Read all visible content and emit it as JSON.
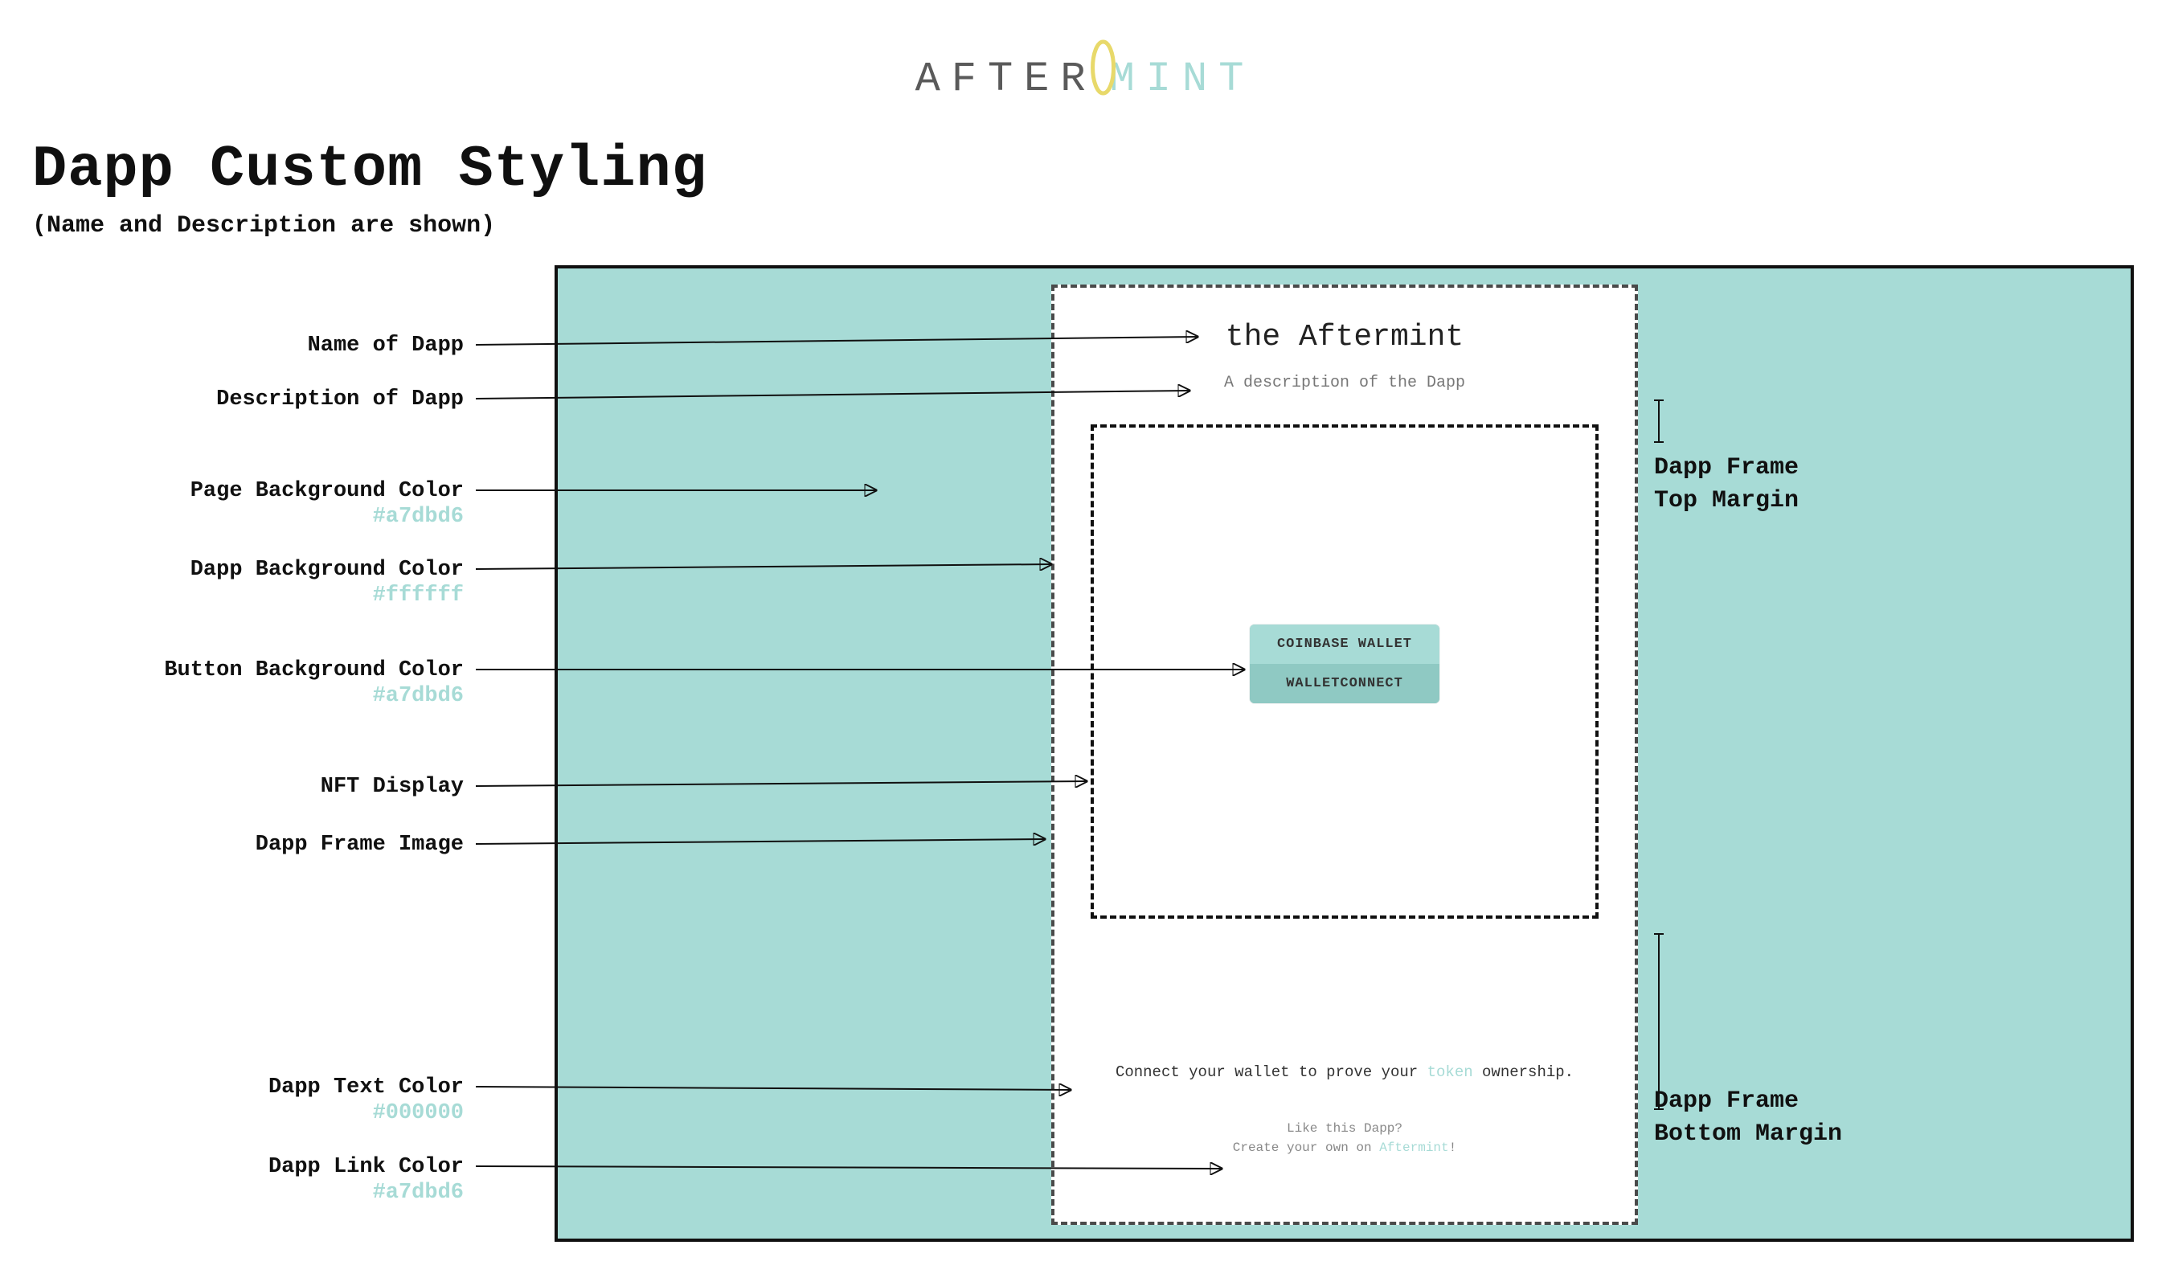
{
  "logo": {
    "left": "AFTER",
    "right": "MINT"
  },
  "heading": {
    "title": "Dapp Custom Styling",
    "subtitle": "(Name and Description are shown)"
  },
  "dapp": {
    "name": "the Aftermint",
    "description": "A description of the Dapp",
    "connect_prefix": "Connect your wallet to prove your ",
    "connect_link": "token",
    "connect_suffix": " ownership.",
    "like": "Like this Dapp?",
    "create_prefix": "Create your own on ",
    "create_link": "Aftermint",
    "create_suffix": "!",
    "btn_coinbase": "COINBASE WALLET",
    "btn_walletconnect": "WALLETCONNECT"
  },
  "labels": {
    "name": "Name of Dapp",
    "desc": "Description of Dapp",
    "page_bg": "Page Background Color",
    "page_bg_hex": "#a7dbd6",
    "dapp_bg": "Dapp Background Color",
    "dapp_bg_hex": "#ffffff",
    "btn_bg": "Button Background Color",
    "btn_bg_hex": "#a7dbd6",
    "nft": "NFT Display",
    "frame_img": "Dapp Frame Image",
    "text_color": "Dapp Text Color",
    "text_color_hex": "#000000",
    "link_color": "Dapp Link Color",
    "link_color_hex": "#a7dbd6"
  },
  "right_labels": {
    "top_margin_l1": "Dapp Frame",
    "top_margin_l2": "Top Margin",
    "bot_margin_l1": "Dapp Frame",
    "bot_margin_l2": "Bottom Margin"
  },
  "colors": {
    "accent": "#a7dbd6",
    "text": "#000000",
    "dapp_bg": "#ffffff"
  }
}
